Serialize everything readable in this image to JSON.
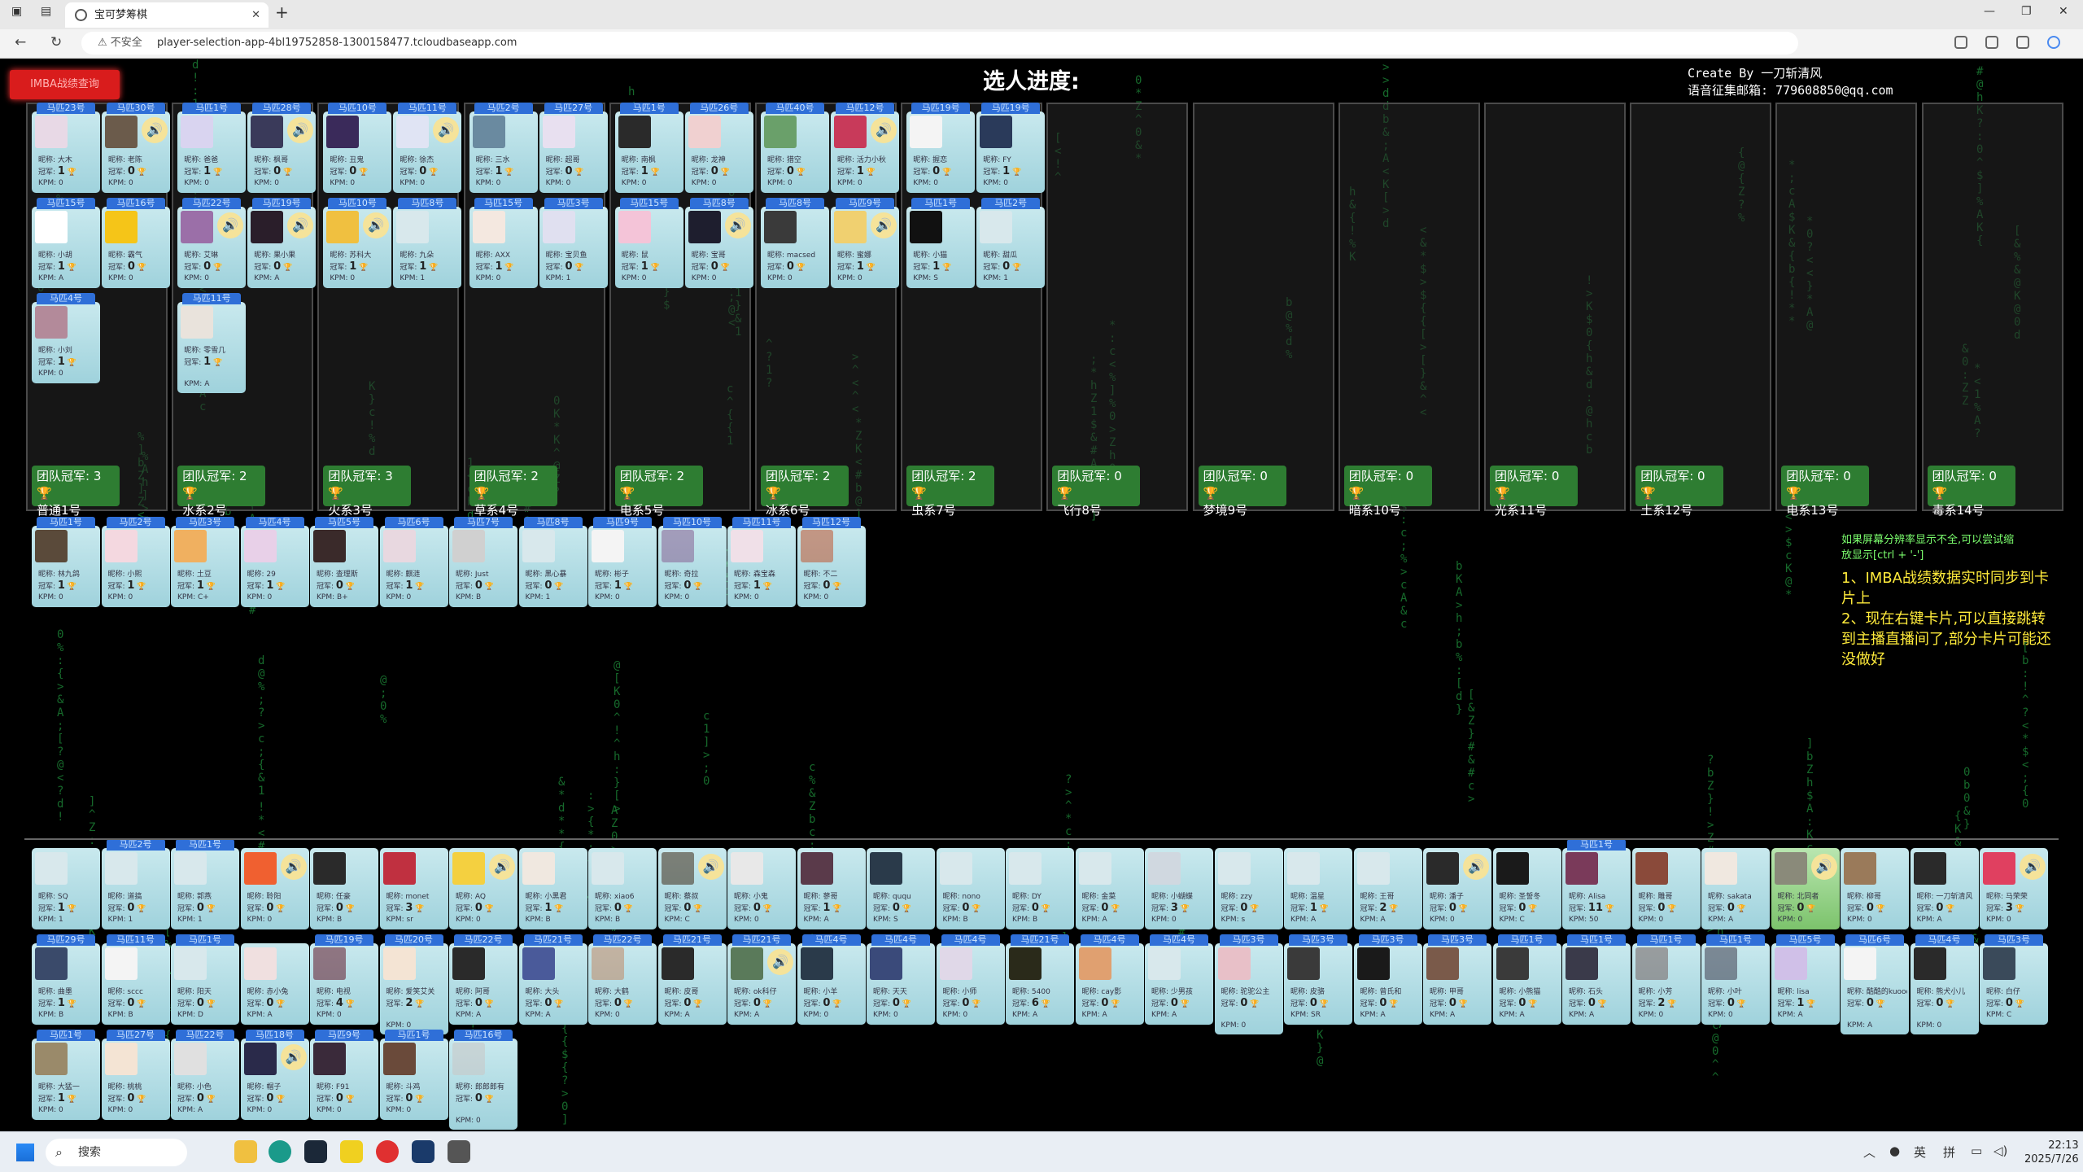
{
  "browser": {
    "tab_title": "宝可梦筹棋",
    "address": "player-selection-app-4bl19752858-1300158477.tcloudbaseapp.com",
    "security_label": "不安全"
  },
  "page": {
    "imba_button": "IMBA战绩查询",
    "title": "选人进度:",
    "credit_line1": "Create By 一刀斩清风",
    "credit_line2": "语音征集邮箱: 779608850@qq.com",
    "info1": "如果屏幕分辨率显示不全,可以尝试缩放显示[ctrl + '-']",
    "info2": "1、IMBA战绩数据实时同步到卡片上\n2、现在右键卡片,可以直接跳转到主播直播间了,部分卡片可能还没做好"
  },
  "teams": [
    {
      "name": "普通1号",
      "champ_label": "团队冠军: 3"
    },
    {
      "name": "水系2号",
      "champ_label": "团队冠军: 2"
    },
    {
      "name": "火系3号",
      "champ_label": "团队冠军: 3"
    },
    {
      "name": "草系4号",
      "champ_label": "团队冠军: 2"
    },
    {
      "name": "电系5号",
      "champ_label": "团队冠军: 2"
    },
    {
      "name": "冰系6号",
      "champ_label": "团队冠军: 2"
    },
    {
      "name": "虫系7号",
      "champ_label": "团队冠军: 2"
    },
    {
      "name": "飞行8号",
      "champ_label": "团队冠军: 0"
    },
    {
      "name": "梦境9号",
      "champ_label": "团队冠军: 0"
    },
    {
      "name": "暗系10号",
      "champ_label": "团队冠军: 0"
    },
    {
      "name": "光系11号",
      "champ_label": "团队冠军: 0"
    },
    {
      "name": "土系12号",
      "champ_label": "团队冠军: 0"
    },
    {
      "name": "电系13号",
      "champ_label": "团队冠军: 0"
    },
    {
      "name": "毒系14号",
      "champ_label": "团队冠军: 0"
    }
  ],
  "team_cards": [
    [
      {
        "tag": "马匹23号",
        "nick": "大木",
        "champ": "1",
        "kpm": "0",
        "color": "#e8d9e6"
      },
      {
        "tag": "马匹30号",
        "nick": "老陈",
        "champ": "0",
        "kpm": "0",
        "color": "#6b5b4b",
        "spk": true
      },
      {
        "tag": "马匹15号",
        "nick": "小胡",
        "champ": "1",
        "kpm": "A",
        "color": "#ffffff"
      },
      {
        "tag": "马匹16号",
        "nick": "霸气",
        "champ": "0",
        "kpm": "0",
        "color": "#f5c518"
      },
      {
        "tag": "马匹4号",
        "nick": "小刘",
        "champ": "1",
        "kpm": "0",
        "color": "#b38a9a"
      }
    ],
    [
      {
        "tag": "马匹1号",
        "nick": "爸爸",
        "champ": "1",
        "kpm": "0",
        "color": "#d9d4f0"
      },
      {
        "tag": "马匹28号",
        "nick": "枫哥",
        "champ": "0",
        "kpm": "0",
        "color": "#3a3a5a",
        "spk": true
      },
      {
        "tag": "马匹22号",
        "nick": "艾琳",
        "champ": "0",
        "kpm": "0",
        "color": "#9b6fa8",
        "spk": true
      },
      {
        "tag": "马匹19号",
        "nick": "果小果",
        "champ": "0",
        "kpm": "A",
        "color": "#2a1e2a",
        "spk": true
      },
      {
        "tag": "马匹11号",
        "nick": "零雪几",
        "champ": "1",
        "kpm": "A",
        "color": "#e9e3dc",
        "tall": true
      }
    ],
    [
      {
        "tag": "马匹10号",
        "nick": "丑鬼",
        "champ": "0",
        "kpm": "0",
        "color": "#3a2a5a"
      },
      {
        "tag": "马匹11号",
        "nick": "徐杰",
        "champ": "0",
        "kpm": "0",
        "color": "#e0e4f4",
        "spk": true
      },
      {
        "tag": "马匹10号",
        "nick": "苏科大",
        "champ": "1",
        "kpm": "0",
        "color": "#f0c040",
        "spk": true
      },
      {
        "tag": "马匹8号",
        "nick": "九朵",
        "champ": "1",
        "kpm": "1",
        "color": "#d8e8ec"
      }
    ],
    [
      {
        "tag": "马匹2号",
        "nick": "三水",
        "champ": "1",
        "kpm": "0",
        "color": "#6a8aa0"
      },
      {
        "tag": "马匹27号",
        "nick": "超哥",
        "champ": "0",
        "kpm": "0",
        "color": "#e8e0f0"
      },
      {
        "tag": "马匹15号",
        "nick": "AXX",
        "champ": "1",
        "kpm": "0",
        "color": "#f4e8e0"
      },
      {
        "tag": "马匹3号",
        "nick": "宝贝鱼",
        "champ": "0",
        "kpm": "1",
        "color": "#e0e0f0"
      }
    ],
    [
      {
        "tag": "马匹1号",
        "nick": "南枫",
        "champ": "1",
        "kpm": "0",
        "color": "#2a2a2a"
      },
      {
        "tag": "马匹26号",
        "nick": "龙神",
        "champ": "0",
        "kpm": "0",
        "color": "#f0d0d0"
      },
      {
        "tag": "马匹15号",
        "nick": "鼠",
        "champ": "1",
        "kpm": "0",
        "color": "#f4c4d8"
      },
      {
        "tag": "马匹8号",
        "nick": "宝哥",
        "champ": "0",
        "kpm": "0",
        "color": "#1e1e2e",
        "spk": true
      }
    ],
    [
      {
        "tag": "马匹40号",
        "nick": "猎空",
        "champ": "0",
        "kpm": "0",
        "color": "#6aa06a"
      },
      {
        "tag": "马匹12号",
        "nick": "活力小秋",
        "champ": "1",
        "kpm": "0",
        "color": "#c83a5a",
        "spk": true
      },
      {
        "tag": "马匹8号",
        "nick": "macsed",
        "champ": "0",
        "kpm": "0",
        "color": "#3a3a3a"
      },
      {
        "tag": "马匹9号",
        "nick": "蜜娜",
        "champ": "1",
        "kpm": "0",
        "color": "#f0d070",
        "spk": true
      }
    ],
    [
      {
        "tag": "马匹19号",
        "nick": "握恋",
        "champ": "0",
        "kpm": "0",
        "color": "#f4f4f4"
      },
      {
        "tag": "马匹19号",
        "nick": "FY",
        "champ": "1",
        "kpm": "0",
        "color": "#2a3a5a"
      },
      {
        "tag": "马匹1号",
        "nick": "小猫",
        "champ": "1",
        "kpm": "S",
        "color": "#111111"
      },
      {
        "tag": "马匹2号",
        "nick": "甜瓜",
        "champ": "0",
        "kpm": "1",
        "color": "#d8e8ec"
      }
    ]
  ],
  "row2": [
    {
      "tag": "马匹1号",
      "nick": "林九鸽",
      "champ": "1",
      "kpm": "0",
      "color": "#5a4a3a"
    },
    {
      "tag": "马匹2号",
      "nick": "小熙",
      "champ": "1",
      "kpm": "0",
      "color": "#f4d8e0"
    },
    {
      "tag": "马匹3号",
      "nick": "土豆",
      "champ": "1",
      "kpm": "C+",
      "color": "#f0b060"
    },
    {
      "tag": "马匹4号",
      "nick": "29",
      "champ": "1",
      "kpm": "0",
      "color": "#e8d0e8"
    },
    {
      "tag": "马匹5号",
      "nick": "查理斯",
      "champ": "0",
      "kpm": "B+",
      "color": "#3a2a2a"
    },
    {
      "tag": "马匹6号",
      "nick": "麒涟",
      "champ": "1",
      "kpm": "0",
      "color": "#e8d8e0"
    },
    {
      "tag": "马匹7号",
      "nick": "Just",
      "champ": "0",
      "kpm": "B",
      "color": "#d0d0d0"
    },
    {
      "tag": "马匹8号",
      "nick": "黑心暴",
      "champ": "0",
      "kpm": "1",
      "color": "#d8e8ec"
    },
    {
      "tag": "马匹9号",
      "nick": "彬子",
      "champ": "1",
      "kpm": "0",
      "color": "#f4f4f4"
    },
    {
      "tag": "马匹10号",
      "nick": "奇拉",
      "champ": "0",
      "kpm": "0",
      "color": "#8a6a9a",
      "dim": true
    },
    {
      "tag": "马匹11号",
      "nick": "森宝森",
      "champ": "1",
      "kpm": "0",
      "color": "#f0e0e8"
    },
    {
      "tag": "马匹12号",
      "nick": "不二",
      "champ": "0",
      "kpm": "0",
      "color": "#c06040",
      "dim": true
    }
  ],
  "pool1": [
    {
      "nick": "SQ",
      "champ": "1",
      "kpm": "1",
      "color": "#d8e8ec"
    },
    {
      "tag": "马匹2号",
      "nick": "道搞",
      "champ": "0",
      "kpm": "1",
      "color": "#d8e8ec"
    },
    {
      "tag": "马匹1号",
      "nick": "郭燕",
      "champ": "0",
      "kpm": "1",
      "color": "#d8e8ec"
    },
    {
      "nick": "聆阳",
      "champ": "0",
      "kpm": "0",
      "color": "#f06030",
      "spk": true
    },
    {
      "nick": "任豪",
      "champ": "0",
      "kpm": "B",
      "color": "#2a2a2a"
    },
    {
      "nick": "monet",
      "champ": "3",
      "kpm": "sr",
      "color": "#c03040"
    },
    {
      "nick": "AQ",
      "champ": "0",
      "kpm": "0",
      "color": "#f4d040",
      "spk": true
    },
    {
      "nick": "小黑君",
      "champ": "1",
      "kpm": "B",
      "color": "#f0e8e0"
    },
    {
      "nick": "xiao6",
      "champ": "0",
      "kpm": "B",
      "color": "#d8e8ec"
    },
    {
      "nick": "蔡叔",
      "champ": "0",
      "kpm": "C",
      "color": "#4a3a2a",
      "spk": true,
      "dim": true
    },
    {
      "nick": "小鬼",
      "champ": "0",
      "kpm": "0",
      "color": "#e8e8e8"
    },
    {
      "nick": "蓼哥",
      "champ": "1",
      "kpm": "A",
      "color": "#5a3a4a"
    },
    {
      "nick": "ququ",
      "champ": "0",
      "kpm": "S",
      "color": "#2a3a4a"
    },
    {
      "nick": "nono",
      "champ": "0",
      "kpm": "B",
      "color": "#d8e8ec"
    },
    {
      "nick": "DY",
      "champ": "0",
      "kpm": "B",
      "color": "#d8e8ec"
    },
    {
      "nick": "金菜",
      "champ": "0",
      "kpm": "A",
      "color": "#d8e8ec"
    },
    {
      "nick": "小蝴蝶",
      "champ": "3",
      "kpm": "0",
      "color": "#d0d8e0"
    },
    {
      "nick": "zzy",
      "champ": "0",
      "kpm": "s",
      "color": "#d8e8ec"
    },
    {
      "nick": "温星",
      "champ": "1",
      "kpm": "A",
      "color": "#d8e8ec"
    },
    {
      "nick": "王哥",
      "champ": "2",
      "kpm": "A",
      "color": "#d8e8ec"
    },
    {
      "nick": "潘子",
      "champ": "0",
      "kpm": "0",
      "color": "#2a2a2a",
      "spk": true
    },
    {
      "nick": "圣誓冬",
      "champ": "0",
      "kpm": "C",
      "color": "#1a1a1a"
    },
    {
      "tag": "马匹1号",
      "nick": "Alisa",
      "champ": "11",
      "kpm": "50",
      "color": "#7a3a5a"
    },
    {
      "nick": "雕哥",
      "champ": "0",
      "kpm": "0",
      "color": "#8a4a3a"
    },
    {
      "nick": "sakata",
      "champ": "0",
      "kpm": "A",
      "color": "#f0e8e0"
    },
    {
      "nick": "北同者",
      "champ": "0",
      "kpm": "0",
      "color": "#8a8a7a",
      "spk": true,
      "green": true
    },
    {
      "nick": "柳哥",
      "champ": "0",
      "kpm": "0",
      "color": "#9a7a5a"
    },
    {
      "nick": "一刀斩清风",
      "champ": "0",
      "kpm": "A",
      "color": "#2a2a2a"
    },
    {
      "nick": "马荣荣",
      "champ": "3",
      "kpm": "0",
      "color": "#e04060",
      "spk": true
    }
  ],
  "pool2": [
    {
      "tag": "马匹29号",
      "nick": "曲墨",
      "champ": "1",
      "kpm": "B",
      "color": "#3a4a6a"
    },
    {
      "tag": "马匹11号",
      "nick": "sccc",
      "champ": "0",
      "kpm": "B",
      "color": "#f4f4f4"
    },
    {
      "tag": "马匹1号",
      "nick": "阳天",
      "champ": "0",
      "kpm": "D",
      "color": "#d8e8ec"
    },
    {
      "nick": "赤小兔",
      "champ": "0",
      "kpm": "A",
      "color": "#f0e0e0"
    },
    {
      "tag": "马匹19号",
      "nick": "电视",
      "champ": "4",
      "kpm": "0",
      "color": "#6a2a3a",
      "dim": true
    },
    {
      "tag": "马匹20号",
      "nick": "爱笑艾关",
      "champ": "2",
      "kpm": "0",
      "color": "#f4e4d4",
      "tall": true
    },
    {
      "tag": "马匹22号",
      "nick": "阿哥",
      "champ": "0",
      "kpm": "A",
      "color": "#2a2a2a"
    },
    {
      "tag": "马匹21号",
      "nick": "大头",
      "champ": "0",
      "kpm": "A",
      "color": "#4a5a9a"
    },
    {
      "tag": "马匹22号",
      "nick": "大鹤",
      "champ": "0",
      "kpm": "0",
      "color": "#c09070",
      "dim": true
    },
    {
      "tag": "马匹21号",
      "nick": "皮哥",
      "champ": "0",
      "kpm": "A",
      "color": "#2a2a2a"
    },
    {
      "tag": "马匹21号",
      "nick": "ok科仔",
      "champ": "0",
      "kpm": "A",
      "color": "#5a7a5a",
      "spk": true
    },
    {
      "tag": "马匹4号",
      "nick": "小羊",
      "champ": "0",
      "kpm": "0",
      "color": "#2a3a4a"
    },
    {
      "tag": "马匹4号",
      "nick": "天天",
      "champ": "0",
      "kpm": "0",
      "color": "#3a4a7a"
    },
    {
      "tag": "马匹4号",
      "nick": "小师",
      "champ": "0",
      "kpm": "0",
      "color": "#e0d8e8"
    },
    {
      "tag": "马匹21号",
      "nick": "5400",
      "champ": "6",
      "kpm": "A",
      "color": "#2a2a1a"
    },
    {
      "tag": "马匹4号",
      "nick": "cay影",
      "champ": "0",
      "kpm": "A",
      "color": "#e0a070"
    },
    {
      "tag": "马匹4号",
      "nick": "少男孩",
      "champ": "0",
      "kpm": "A",
      "color": "#d8e8ec"
    },
    {
      "tag": "马匹3号",
      "nick": "驼驼公主",
      "champ": "0",
      "kpm": "0",
      "color": "#e8c0c8",
      "tall": true
    },
    {
      "tag": "马匹3号",
      "nick": "皮骆",
      "champ": "0",
      "kpm": "SR",
      "color": "#3a3a3a"
    },
    {
      "tag": "马匹3号",
      "nick": "曾氏和",
      "champ": "0",
      "kpm": "A",
      "color": "#1a1a1a"
    },
    {
      "tag": "马匹3号",
      "nick": "甲哥",
      "champ": "0",
      "kpm": "A",
      "color": "#7a5a4a"
    },
    {
      "tag": "马匹1号",
      "nick": "小熊猫",
      "champ": "0",
      "kpm": "A",
      "color": "#3a3a3a"
    },
    {
      "tag": "马匹1号",
      "nick": "石头",
      "champ": "0",
      "kpm": "A",
      "color": "#3a3a4a"
    },
    {
      "tag": "马匹1号",
      "nick": "小芳",
      "champ": "2",
      "kpm": "0",
      "color": "#7a6a6a",
      "dim": true
    },
    {
      "tag": "马匹1号",
      "nick": "小叶",
      "champ": "0",
      "kpm": "0",
      "color": "#4a4a5a",
      "dim": true
    },
    {
      "tag": "马匹5号",
      "nick": "lisa",
      "champ": "1",
      "kpm": "A",
      "color": "#d0c0e8"
    },
    {
      "tag": "马匹6号",
      "nick": "酷酷的kuooo",
      "champ": "0",
      "kpm": "A",
      "color": "#f4f4f4",
      "tall": true
    },
    {
      "tag": "马匹4号",
      "nick": "熊犬小儿",
      "champ": "0",
      "kpm": "0",
      "color": "#2a2a2a",
      "tall": true
    },
    {
      "tag": "马匹3号",
      "nick": "白仔",
      "champ": "0",
      "kpm": "C",
      "color": "#3a4a5a"
    }
  ],
  "pool3": [
    {
      "tag": "马匹1号",
      "nick": "大猛一",
      "champ": "1",
      "kpm": "0",
      "color": "#9a8a6a"
    },
    {
      "tag": "马匹27号",
      "nick": "桃桃",
      "champ": "0",
      "kpm": "0",
      "color": "#f4e4d4"
    },
    {
      "tag": "马匹22号",
      "nick": "小色",
      "champ": "0",
      "kpm": "A",
      "color": "#e0e0e0"
    },
    {
      "tag": "马匹18号",
      "nick": "帽子",
      "champ": "0",
      "kpm": "0",
      "color": "#2a2a4a",
      "spk": true
    },
    {
      "tag": "马匹9号",
      "nick": "F91",
      "champ": "0",
      "kpm": "0",
      "color": "#3a2a3a"
    },
    {
      "tag": "马匹1号",
      "nick": "斗鸡",
      "champ": "0",
      "kpm": "0",
      "color": "#6a4a3a"
    },
    {
      "tag": "马匹16号",
      "nick": "郎郎郎有",
      "champ": "0",
      "kpm": "0",
      "color": "#c8c8c8",
      "tall": true,
      "dim": true
    }
  ],
  "labels": {
    "nick": "昵称: ",
    "champ": "冠军: ",
    "kpm": "KPM: ",
    "speaker": "🔊",
    "cup": "🏆"
  },
  "taskbar": {
    "search": "搜索",
    "time": "22:13",
    "date": "2025/7/26",
    "ime1": "英",
    "ime2": "拼"
  }
}
